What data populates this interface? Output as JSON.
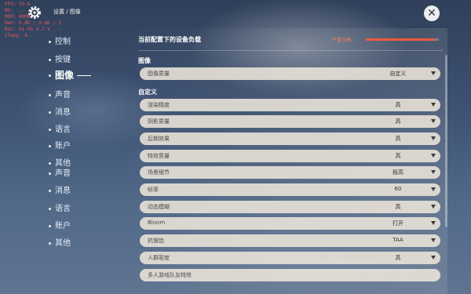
{
  "debug_overlay": {
    "lines": [
      "FPS: 59.0",
      "MS: ...",
      "MEM: 80MB",
      "Net: 0.8K | 0.6K | 1",
      "Bat: 61.0% 4.7 V ...",
      "CTemp: 4..."
    ]
  },
  "breadcrumb": "设置 / 图像",
  "close_icon": "close-icon",
  "sidebar": {
    "items": [
      {
        "label": "控制"
      },
      {
        "label": "按键"
      },
      {
        "label": "图像"
      },
      {
        "label": "声音"
      },
      {
        "label": "消息"
      },
      {
        "label": "语言"
      },
      {
        "label": "账户"
      },
      {
        "label": "其他"
      },
      {
        "label": "声音"
      },
      {
        "label": "消息"
      },
      {
        "label": "语言"
      },
      {
        "label": "账户"
      },
      {
        "label": "其他"
      }
    ],
    "active_index": 2
  },
  "device_load": {
    "title": "当前配置下的设备负载",
    "status_label": "严重过高",
    "level": 0.95,
    "color": "#ee5a3a"
  },
  "sections": {
    "image": "图像",
    "custom": "自定义"
  },
  "settings": [
    {
      "label": "图像质量",
      "value": "自定义"
    },
    {
      "label": "渲染精度",
      "value": "高"
    },
    {
      "label": "阴影质量",
      "value": "高"
    },
    {
      "label": "后期效果",
      "value": "高"
    },
    {
      "label": "特效质量",
      "value": "高"
    },
    {
      "label": "场景细节",
      "value": "极高"
    },
    {
      "label": "帧率",
      "value": "60"
    },
    {
      "label": "动态模糊",
      "value": "高"
    },
    {
      "label": "Bloom",
      "value": "打开"
    },
    {
      "label": "抗锯齿",
      "value": "TAA"
    },
    {
      "label": "人群密度",
      "value": "高"
    },
    {
      "label": "多人游戏队友特效",
      "value": ""
    }
  ]
}
